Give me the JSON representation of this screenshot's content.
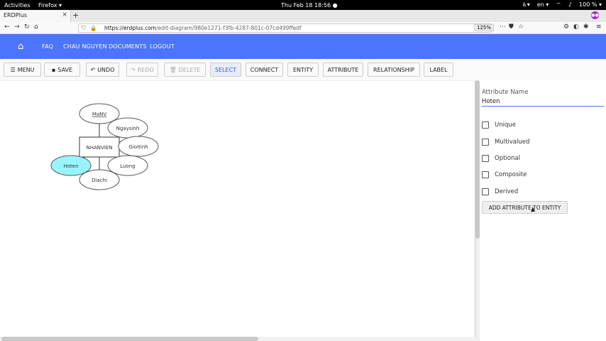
{
  "system_bar": {
    "activities": "Activities",
    "app_menu": "Firefox ▾",
    "clock": "Thu Feb 18  18:56  ●",
    "lang": "en ▾",
    "battery": "100 % ▾"
  },
  "browser": {
    "tab_title": "ERDPlus",
    "url_host": "https://erdplus.com",
    "url_path": "/edit-diagram/980e1271-f3fb-4287-801c-07cd499ffedf",
    "zoom": "125%"
  },
  "appbar": {
    "links": [
      "FAQ",
      "CHAU NGUYEN",
      "DOCUMENTS",
      "LOGOUT"
    ]
  },
  "toolbar": {
    "menu": "MENU",
    "save": "SAVE",
    "undo": "UNDO",
    "redo": "REDO",
    "delete": "DELETE",
    "select": "SELECT",
    "connect": "CONNECT",
    "entity": "ENTITY",
    "attribute": "ATTRIBUTE",
    "relationship": "RELATIONSHIP",
    "label": "LABEL"
  },
  "diagram": {
    "entity": "NHANVIEN",
    "attributes": {
      "manv": "MaNV",
      "ngaysinh": "Ngaysinh",
      "gioitinh": "Gioitinh",
      "hoten": "Hoten",
      "luong": "Luong",
      "diachi": "Diachi"
    },
    "selected_fill": "#99f5fb"
  },
  "panel": {
    "attribute_name_label": "Attribute Name",
    "attribute_name_value": "Hoten",
    "options": [
      "Unique",
      "Multivalued",
      "Optional",
      "Composite",
      "Derived"
    ],
    "add_button": "ADD ATTRIBUTE TO ENTITY"
  }
}
